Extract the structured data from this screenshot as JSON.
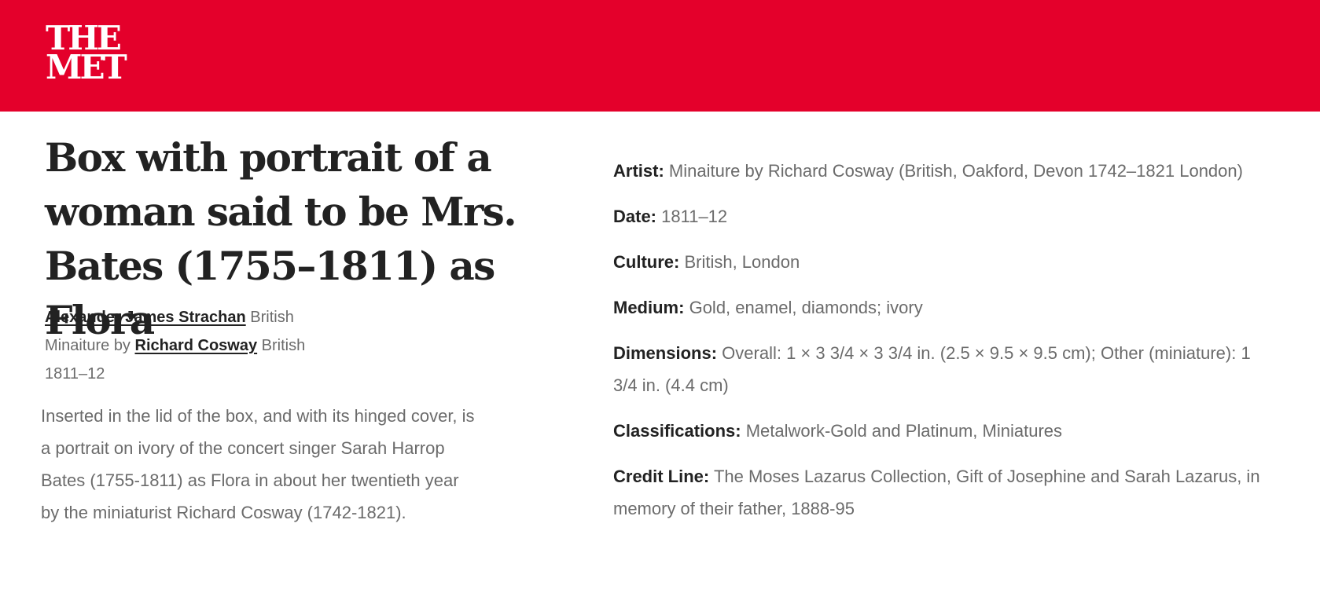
{
  "header": {
    "logo_line1": "THE",
    "logo_line2": "MET",
    "color": "#e4002b"
  },
  "artwork": {
    "title": "Box with portrait of a woman said to be Mrs. Bates (1755–1811) as Flora",
    "maker": {
      "name": "Alexander James Strachan",
      "nationality": "British"
    },
    "miniature": {
      "prefix": "Minaiture by",
      "name": "Richard Cosway",
      "nationality": "British"
    },
    "date_short": "1811–12",
    "description": "Inserted in the lid of the box, and with its hinged cover, is a portrait on ivory of the concert singer Sarah Harrop Bates (1755-1811) as Flora in about her twentieth year by the miniaturist Richard Cosway (1742-1821)."
  },
  "details": {
    "artist": {
      "label": "Artist:",
      "value": "Minaiture by Richard Cosway (British, Oakford, Devon 1742–1821 London)"
    },
    "date": {
      "label": "Date:",
      "value": "1811–12"
    },
    "culture": {
      "label": "Culture:",
      "value": "British, London"
    },
    "medium": {
      "label": "Medium:",
      "value": "Gold, enamel, diamonds; ivory"
    },
    "dimensions": {
      "label": "Dimensions:",
      "value": "Overall: 1 × 3 3/4 × 3 3/4 in. (2.5 × 9.5 × 9.5 cm); Other (miniature): 1 3/4 in. (4.4 cm)"
    },
    "classifications": {
      "label": "Classifications:",
      "value": "Metalwork-Gold and Platinum, Miniatures"
    },
    "credit_line": {
      "label": "Credit Line:",
      "value": "The Moses Lazarus Collection, Gift of Josephine and Sarah Lazarus, in memory of their father, 1888-95"
    }
  }
}
